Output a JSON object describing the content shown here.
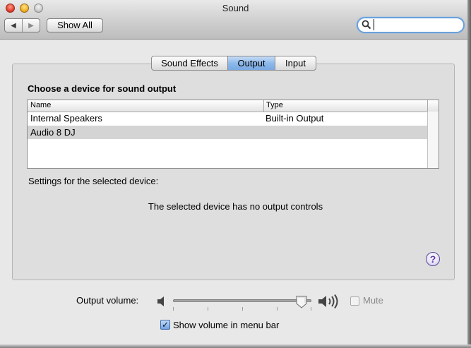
{
  "window": {
    "title": "Sound",
    "show_all_label": "Show All",
    "back_glyph": "◀",
    "forward_glyph": "▶",
    "search_value": ""
  },
  "tabs": [
    {
      "label": "Sound Effects",
      "selected": false
    },
    {
      "label": "Output",
      "selected": true
    },
    {
      "label": "Input",
      "selected": false
    }
  ],
  "output": {
    "heading": "Choose a device for sound output",
    "columns": [
      "Name",
      "Type"
    ],
    "devices": [
      {
        "name": "Internal Speakers",
        "type": "Built-in Output",
        "selected": false
      },
      {
        "name": "Audio 8 DJ",
        "type": "",
        "selected": true
      }
    ],
    "settings_label": "Settings for the selected device:",
    "no_controls_text": "The selected device has no output controls",
    "help_glyph": "?"
  },
  "volume": {
    "label": "Output volume:",
    "level_fraction": 0.93,
    "mute_label": "Mute",
    "mute_checked": false,
    "menu_bar_label": "Show volume in menu bar",
    "menu_bar_checked": true,
    "check_glyph": "✓"
  },
  "icons": {
    "search": "search-icon",
    "speaker_low": "speaker-low-icon",
    "speaker_high": "speaker-high-icon",
    "help": "help-icon"
  },
  "colors": {
    "selected_tab": "#8db8ea",
    "search_focus": "#6aa0dc",
    "help_purple": "#5b3aa8"
  }
}
